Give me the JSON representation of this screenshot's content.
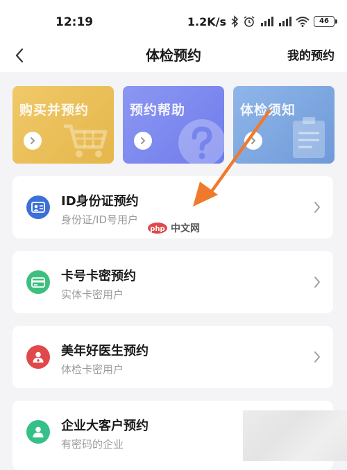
{
  "status_bar": {
    "time": "12:19",
    "net_speed": "1.2K/s",
    "battery": "46"
  },
  "nav": {
    "title": "体检预约",
    "right_link": "我的预约"
  },
  "banners": [
    {
      "label": "购买并预约",
      "color": "#e9bd55"
    },
    {
      "label": "预约帮助",
      "color": "#7b87ef"
    },
    {
      "label": "体检须知",
      "color": "#7ea6df"
    }
  ],
  "options": [
    {
      "title": "ID身份证预约",
      "subtitle": "身份证/ID号用户",
      "icon": "id-card-icon",
      "color": "#3d6fd9"
    },
    {
      "title": "卡号卡密预约",
      "subtitle": "实体卡密用户",
      "icon": "card-icon",
      "color": "#3fbf7f"
    },
    {
      "title": "美年好医生预约",
      "subtitle": "体检卡密用户",
      "icon": "doctor-icon",
      "color": "#e0484a"
    },
    {
      "title": "企业大客户预约",
      "subtitle": "有密码的企业",
      "icon": "enterprise-user-icon",
      "color": "#35c08a"
    }
  ],
  "watermark": {
    "logo": "php",
    "text": "中文网"
  },
  "annotation_color": "#f07a2c"
}
